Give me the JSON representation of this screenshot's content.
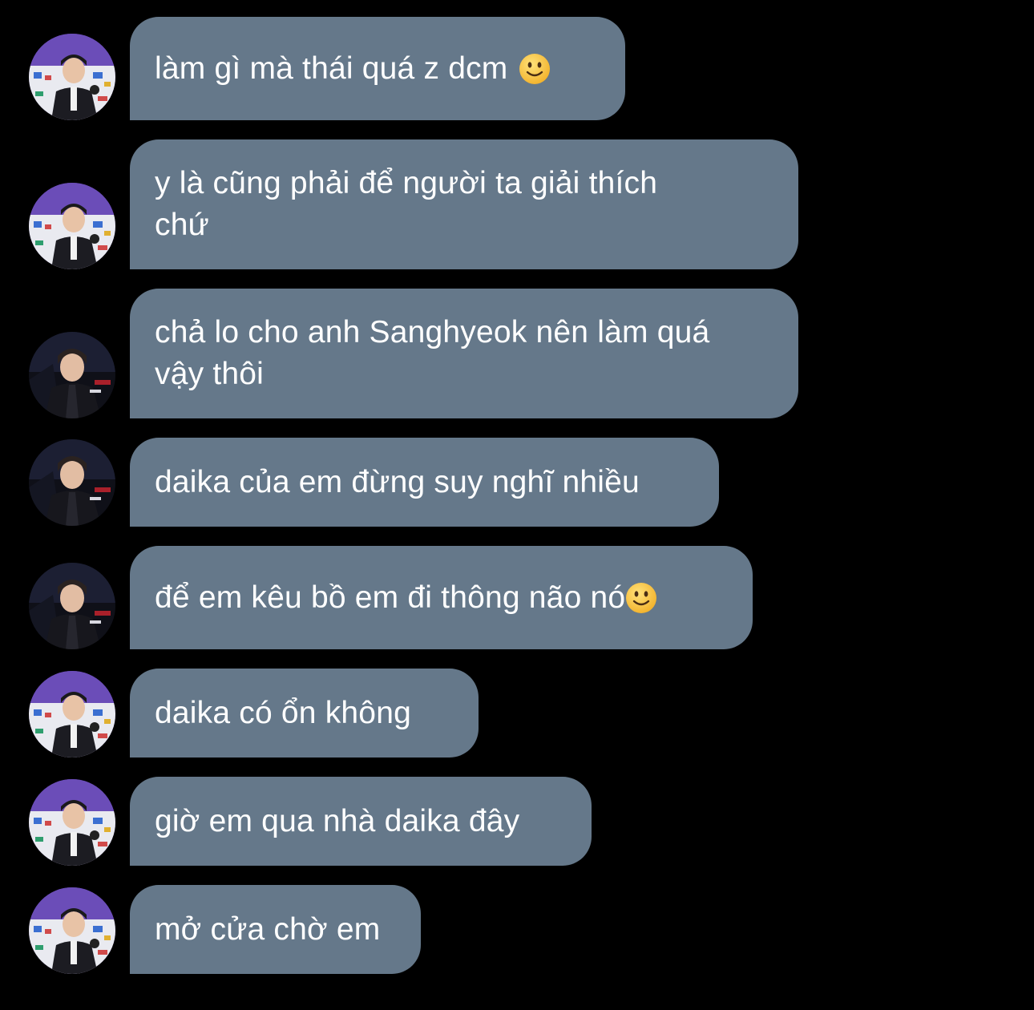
{
  "chat": {
    "messages": [
      {
        "text": "làm gì mà thái quá z dcm",
        "emoji": "slightly-smiling-face",
        "avatar": "avatar-a"
      },
      {
        "text": "y là cũng phải để người ta giải thích\nchứ",
        "emoji": null,
        "avatar": "avatar-a"
      },
      {
        "text": "chả lo cho anh Sanghyeok nên làm quá\nvậy thôi",
        "emoji": null,
        "avatar": "avatar-b"
      },
      {
        "text": "daika của em đừng suy nghĩ nhiều",
        "emoji": null,
        "avatar": "avatar-b"
      },
      {
        "text": "để em kêu bồ em đi thông não nó",
        "emoji": "slightly-smiling-face",
        "avatar": "avatar-b"
      },
      {
        "text": "daika có ổn không",
        "emoji": null,
        "avatar": "avatar-a"
      },
      {
        "text": "giờ em qua nhà daika đây",
        "emoji": null,
        "avatar": "avatar-a"
      },
      {
        "text": "mở cửa chờ em",
        "emoji": null,
        "avatar": "avatar-a"
      }
    ]
  },
  "colors": {
    "background": "#000000",
    "bubble": "#65788a",
    "text": "#ffffff",
    "emoji": "#f6c13a"
  }
}
